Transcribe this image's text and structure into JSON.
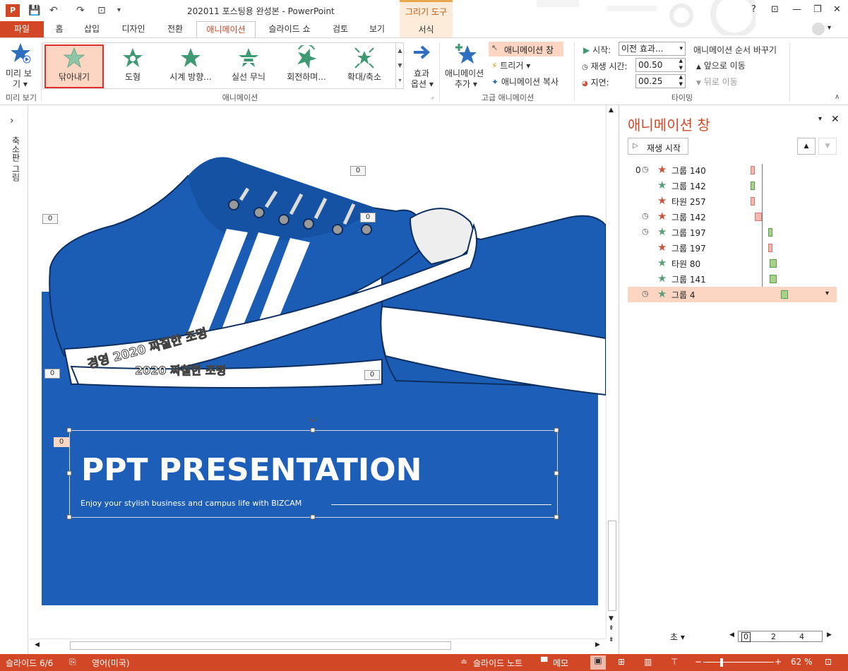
{
  "titlebar": {
    "title": "202011 포스팅용 완성본 - PowerPoint",
    "context_tools": "그리기 도구",
    "context_tab": "서식",
    "help": "?",
    "minimize": "—",
    "restore": "❐",
    "close": "✕"
  },
  "tabs": [
    "파일",
    "홈",
    "삽입",
    "디자인",
    "전환",
    "애니메이션",
    "슬라이드 쇼",
    "검토",
    "보기"
  ],
  "ribbon": {
    "preview_label_1": "미리 보",
    "preview_label_2": "기",
    "preview_group": "미리 보기",
    "gallery": [
      "닦아내기",
      "도형",
      "시계 방향...",
      "실선 무늬",
      "회전하며...",
      "확대/축소"
    ],
    "effect_options_1": "효과",
    "effect_options_2": "옵션",
    "animation_group": "애니메이션",
    "add_animation_1": "애니메이션",
    "add_animation_2": "추가",
    "anim_pane_btn": "애니메이션 창",
    "trigger": "트리거",
    "anim_painter": "애니메이션 복사",
    "advanced_group": "고급 애니메이션",
    "start_label": "시작:",
    "start_value": "이전 효과...",
    "duration_label": "재생 시간:",
    "duration_value": "00.50",
    "delay_label": "지연:",
    "delay_value": "00.25",
    "reorder_title": "애니메이션 순서 바꾸기",
    "move_earlier": "앞으로 이동",
    "move_later": "뒤로 이동",
    "timing_group": "타이밍"
  },
  "leftpane": {
    "label": "축소판 그림",
    "arrow": "›"
  },
  "slide": {
    "shoe_text_1": "경영 2020 짜칠한 조명",
    "shoe_text_2": "2020 짜칠한 조명",
    "title": "PPT PRESENTATION",
    "subtitle": "Enjoy your stylish business and campus life with BIZCAM",
    "tag0": "0"
  },
  "animpane": {
    "title": "애니메이션 창",
    "play": "재생 시작",
    "first_index": "0",
    "items": [
      {
        "name": "그룹 140",
        "clock": true,
        "color": "#c8553d",
        "bar": "#f4b8b0"
      },
      {
        "name": "그룹 142",
        "clock": false,
        "color": "#5a9e7a",
        "bar": "#a9d18e"
      },
      {
        "name": "타원 257",
        "clock": false,
        "color": "#c8553d",
        "bar": "#f4b8b0"
      },
      {
        "name": "그룹 142",
        "clock": true,
        "color": "#c8553d",
        "bar": "#f4b8b0"
      },
      {
        "name": "그룹 197",
        "clock": true,
        "color": "#5a9e7a",
        "bar": "#a9d18e"
      },
      {
        "name": "그룹 197",
        "clock": false,
        "color": "#c8553d",
        "bar": "#f4b8b0"
      },
      {
        "name": "타원 80",
        "clock": false,
        "color": "#5a9e7a",
        "bar": "#a9d18e"
      },
      {
        "name": "그룹 141",
        "clock": false,
        "color": "#5a9e7a",
        "bar": "#a9d18e"
      },
      {
        "name": "그룹 4",
        "clock": true,
        "color": "#5a9e7a",
        "bar": "#a9d18e"
      }
    ],
    "seconds": "초",
    "scale": [
      "0",
      "2",
      "4"
    ]
  },
  "status": {
    "slide": "슬라이드 6/6",
    "lang": "영어(미국)",
    "notes": "슬라이드 노트",
    "comments": "메모",
    "zoom": "62 %"
  }
}
